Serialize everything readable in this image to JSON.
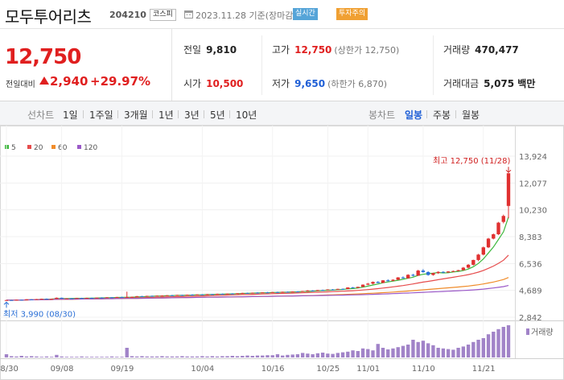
{
  "header": {
    "stock_name": "모두투어리츠",
    "stock_code": "204210",
    "market": "코스피",
    "date": "2023.11.28 기준(장마감)",
    "badge_realtime": "실시간",
    "badge_warning": "투자주의"
  },
  "summary": {
    "price": "12,750",
    "prev_label": "전일대비",
    "change": "2,940",
    "change_pct": "+29.97%",
    "prev_close_label": "전일",
    "prev_close": "9,810",
    "high_label": "고가",
    "high": "12,750",
    "high_limit": "(상한가 12,750)",
    "volume_label": "거래량",
    "volume": "470,477",
    "open_label": "시가",
    "open": "10,500",
    "low_label": "저가",
    "low": "9,650",
    "low_limit": "(하한가 6,870)",
    "amount_label": "거래대금",
    "amount": "5,075 백만"
  },
  "tabs": {
    "line_label": "선차트",
    "periods": [
      "1일",
      "1주일",
      "3개월",
      "1년",
      "3년",
      "5년",
      "10년"
    ],
    "candle_label": "봉차트",
    "candle_types": [
      "일봉",
      "주봉",
      "월봉"
    ]
  },
  "legend": [
    {
      "name": "5",
      "color": "#3db83d"
    },
    {
      "name": "20",
      "color": "#e64c4c"
    },
    {
      "name": "60",
      "color": "#f08c2a"
    },
    {
      "name": "120",
      "color": "#9b59c8"
    }
  ],
  "chart_data": {
    "type": "candlestick",
    "y_ticks": [
      "13,924",
      "12,077",
      "10,230",
      "8,383",
      "6,536",
      "4,689",
      "2,842"
    ],
    "ylim": [
      2842,
      13924
    ],
    "x_ticks": [
      "08/30",
      "09/08",
      "09/19",
      "10/04",
      "10/16",
      "10/25",
      "11/01",
      "11/10",
      "11/21"
    ],
    "high_annotation": "최고 12,750 (11/28)",
    "low_annotation": "최저 3,990 (08/30)",
    "volume_label": "거래량",
    "candles": [
      [
        4010,
        4030,
        3990,
        4020
      ],
      [
        4020,
        4040,
        4000,
        4010
      ],
      [
        4010,
        4050,
        4000,
        4040
      ],
      [
        4040,
        4060,
        4020,
        4030
      ],
      [
        4030,
        4080,
        4020,
        4070
      ],
      [
        4070,
        4090,
        4040,
        4060
      ],
      [
        4060,
        4100,
        4050,
        4090
      ],
      [
        4090,
        4120,
        4070,
        4110
      ],
      [
        4110,
        4130,
        4080,
        4090
      ],
      [
        4090,
        4120,
        4070,
        4100
      ],
      [
        4100,
        4200,
        4090,
        4180
      ],
      [
        4180,
        4190,
        4100,
        4120
      ],
      [
        4120,
        4150,
        4100,
        4140
      ],
      [
        4140,
        4160,
        4110,
        4130
      ],
      [
        4130,
        4170,
        4120,
        4160
      ],
      [
        4160,
        4180,
        4130,
        4150
      ],
      [
        4150,
        4180,
        4140,
        4170
      ],
      [
        4170,
        4190,
        4140,
        4160
      ],
      [
        4160,
        4200,
        4150,
        4190
      ],
      [
        4190,
        4210,
        4160,
        4180
      ],
      [
        4180,
        4220,
        4170,
        4210
      ],
      [
        4210,
        4230,
        4180,
        4200
      ],
      [
        4200,
        4240,
        4190,
        4230
      ],
      [
        4230,
        4250,
        4200,
        4210
      ],
      [
        4210,
        4600,
        4200,
        4230
      ],
      [
        4230,
        4260,
        4200,
        4240
      ],
      [
        4240,
        4300,
        4230,
        4290
      ],
      [
        4290,
        4310,
        4260,
        4270
      ],
      [
        4270,
        4320,
        4260,
        4310
      ],
      [
        4310,
        4330,
        4280,
        4300
      ],
      [
        4300,
        4340,
        4290,
        4320
      ],
      [
        4320,
        4350,
        4300,
        4330
      ],
      [
        4330,
        4360,
        4310,
        4350
      ],
      [
        4350,
        4380,
        4320,
        4340
      ],
      [
        4340,
        4380,
        4330,
        4370
      ],
      [
        4370,
        4390,
        4340,
        4360
      ],
      [
        4360,
        4400,
        4350,
        4390
      ],
      [
        4390,
        4420,
        4360,
        4380
      ],
      [
        4380,
        4420,
        4370,
        4410
      ],
      [
        4410,
        4430,
        4380,
        4400
      ],
      [
        4400,
        4440,
        4390,
        4430
      ],
      [
        4430,
        4450,
        4400,
        4420
      ],
      [
        4420,
        4460,
        4410,
        4450
      ],
      [
        4450,
        4470,
        4420,
        4440
      ],
      [
        4440,
        4480,
        4430,
        4470
      ],
      [
        4470,
        4490,
        4440,
        4460
      ],
      [
        4460,
        4500,
        4450,
        4490
      ],
      [
        4490,
        4520,
        4470,
        4510
      ],
      [
        4510,
        4530,
        4480,
        4500
      ],
      [
        4500,
        4540,
        4490,
        4530
      ],
      [
        4530,
        4560,
        4500,
        4520
      ],
      [
        4520,
        4560,
        4510,
        4550
      ],
      [
        4550,
        4580,
        4520,
        4540
      ],
      [
        4540,
        4580,
        4530,
        4570
      ],
      [
        4570,
        4600,
        4540,
        4560
      ],
      [
        4560,
        4600,
        4550,
        4590
      ],
      [
        4590,
        4610,
        4560,
        4580
      ],
      [
        4580,
        4620,
        4570,
        4610
      ],
      [
        4610,
        4630,
        4580,
        4600
      ],
      [
        4600,
        4650,
        4590,
        4640
      ],
      [
        4640,
        4700,
        4620,
        4680
      ],
      [
        4680,
        4700,
        4640,
        4660
      ],
      [
        4660,
        4720,
        4650,
        4710
      ],
      [
        4710,
        4740,
        4680,
        4700
      ],
      [
        4700,
        4760,
        4690,
        4750
      ],
      [
        4750,
        4780,
        4720,
        4740
      ],
      [
        4740,
        4800,
        4730,
        4790
      ],
      [
        4790,
        4820,
        4760,
        4780
      ],
      [
        4780,
        4900,
        4770,
        4890
      ],
      [
        4890,
        4920,
        4840,
        4860
      ],
      [
        4860,
        4940,
        4850,
        4930
      ],
      [
        4930,
        5100,
        4920,
        5080
      ],
      [
        5080,
        5200,
        5050,
        5150
      ],
      [
        5150,
        5300,
        5100,
        5270
      ],
      [
        5270,
        5320,
        5180,
        5200
      ],
      [
        5200,
        5400,
        5190,
        5380
      ],
      [
        5380,
        5450,
        5300,
        5350
      ],
      [
        5350,
        5450,
        5320,
        5420
      ],
      [
        5420,
        5600,
        5400,
        5580
      ],
      [
        5580,
        5650,
        5500,
        5520
      ],
      [
        5520,
        5800,
        5500,
        5760
      ],
      [
        5760,
        5820,
        5650,
        5700
      ],
      [
        5700,
        6100,
        5690,
        6050
      ],
      [
        6050,
        6150,
        5900,
        5950
      ],
      [
        5950,
        6000,
        5700,
        5750
      ],
      [
        5750,
        5900,
        5700,
        5880
      ],
      [
        5880,
        6000,
        5820,
        5960
      ],
      [
        5960,
        6000,
        5880,
        5920
      ],
      [
        5920,
        6010,
        5900,
        5990
      ],
      [
        5990,
        6050,
        5950,
        6020
      ],
      [
        6020,
        6100,
        6000,
        6080
      ],
      [
        6080,
        6300,
        6060,
        6250
      ],
      [
        6250,
        6500,
        6200,
        6450
      ],
      [
        6450,
        6800,
        6400,
        6780
      ],
      [
        6780,
        7200,
        6700,
        7150
      ],
      [
        7150,
        7700,
        7100,
        7650
      ],
      [
        7650,
        8300,
        7600,
        8250
      ],
      [
        8250,
        8600,
        8200,
        8550
      ],
      [
        8550,
        9400,
        8500,
        9350
      ],
      [
        9400,
        9900,
        9300,
        9810
      ],
      [
        10500,
        12750,
        9650,
        12750
      ]
    ],
    "volumes": [
      10,
      4,
      3,
      5,
      3,
      4,
      3,
      2,
      3,
      2,
      8,
      3,
      2,
      2,
      2,
      3,
      2,
      2,
      2,
      2,
      2,
      3,
      2,
      2,
      30,
      4,
      3,
      4,
      3,
      3,
      3,
      4,
      3,
      3,
      3,
      4,
      3,
      3,
      3,
      4,
      3,
      4,
      3,
      4,
      4,
      5,
      4,
      5,
      6,
      5,
      6,
      6,
      7,
      7,
      10,
      6,
      8,
      9,
      10,
      14,
      12,
      10,
      13,
      15,
      12,
      11,
      14,
      16,
      18,
      22,
      20,
      28,
      26,
      22,
      42,
      30,
      25,
      28,
      32,
      36,
      40,
      55,
      48,
      52,
      44,
      38,
      30,
      28,
      26,
      24,
      30,
      34,
      40,
      48,
      55,
      60,
      72,
      80,
      88,
      95,
      100
    ]
  }
}
